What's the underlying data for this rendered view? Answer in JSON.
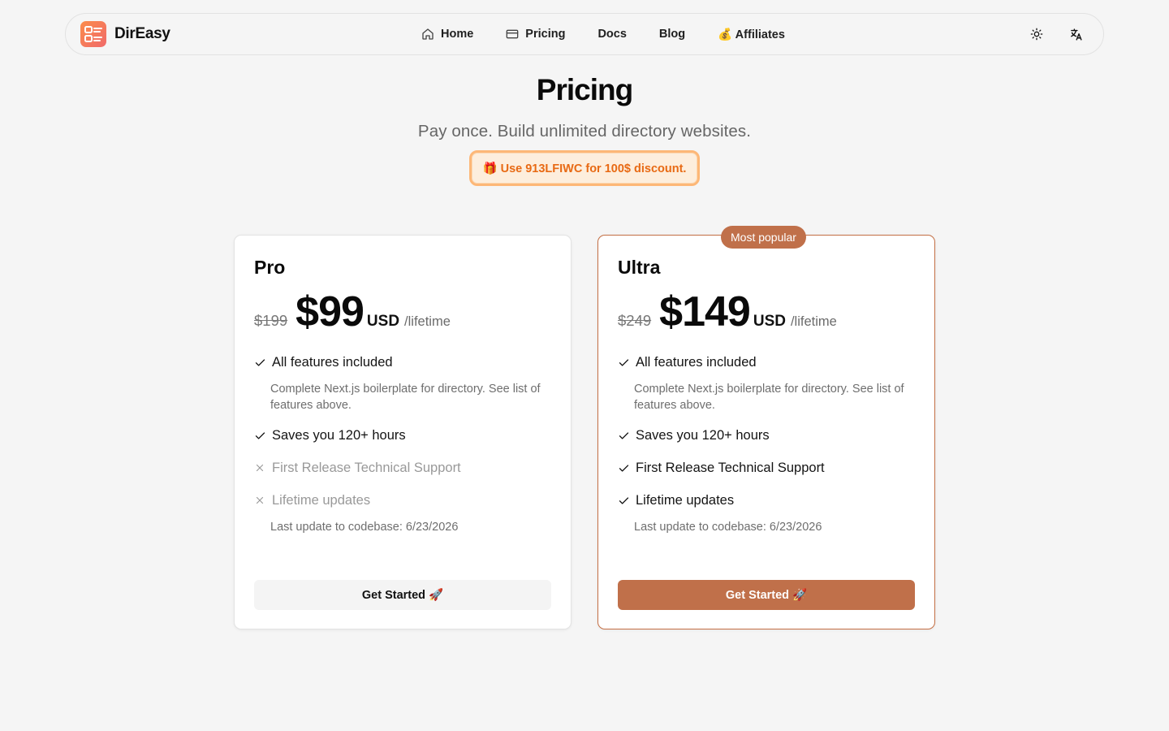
{
  "brand": {
    "name": "DirEasy"
  },
  "nav": {
    "items": [
      {
        "label": "Home",
        "icon": "home-icon"
      },
      {
        "label": "Pricing",
        "icon": "card-icon"
      },
      {
        "label": "Docs"
      },
      {
        "label": "Blog"
      },
      {
        "label": "💰 Affiliates"
      }
    ],
    "theme_icon": "sun-icon",
    "language_icon": "translate-icon"
  },
  "header": {
    "title": "Pricing",
    "subtitle": "Pay once. Build unlimited directory websites.",
    "coupon": "🎁 Use 913LFIWC for 100$ discount."
  },
  "plans": [
    {
      "name": "Pro",
      "old_price": "$199",
      "price": "$99",
      "currency": "USD",
      "period": "/lifetime",
      "features": [
        {
          "label": "All features included",
          "included": true
        },
        {
          "label": "Saves you 120+ hours",
          "included": true
        },
        {
          "label": "First Release Technical Support",
          "included": false
        },
        {
          "label": "Lifetime updates",
          "included": false
        }
      ],
      "note_1": "Complete Next.js boilerplate for directory. See list of features above.",
      "note_2": "Last update to codebase: 6/23/2026",
      "cta": "Get Started 🚀"
    },
    {
      "name": "Ultra",
      "badge": "Most popular",
      "old_price": "$249",
      "price": "$149",
      "currency": "USD",
      "period": "/lifetime",
      "features": [
        {
          "label": "All features included",
          "included": true
        },
        {
          "label": "Saves you 120+ hours",
          "included": true
        },
        {
          "label": "First Release Technical Support",
          "included": true
        },
        {
          "label": "Lifetime updates",
          "included": true
        }
      ],
      "note_1": "Complete Next.js boilerplate for directory. See list of features above.",
      "note_2": "Last update to codebase: 6/23/2026",
      "cta": "Get Started 🚀"
    }
  ],
  "colors": {
    "accent": "#c0704a",
    "coupon_text": "#e86a14",
    "coupon_border": "#fdb777"
  }
}
